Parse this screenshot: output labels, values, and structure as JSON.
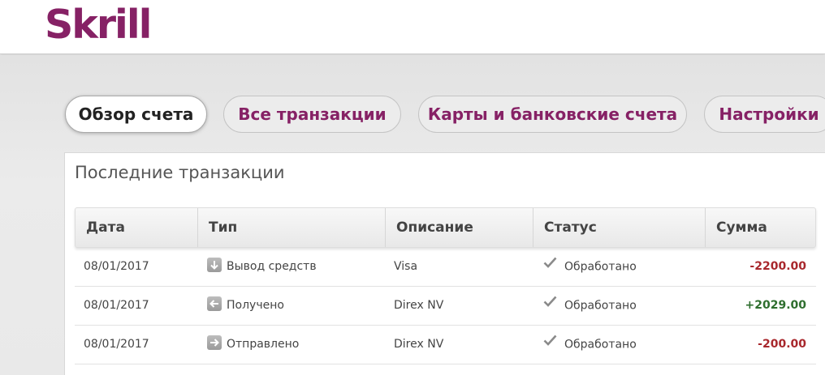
{
  "header": {
    "logo_text": "Skrill"
  },
  "tabs": [
    {
      "label": "Обзор счета",
      "active": true
    },
    {
      "label": "Все транзакции",
      "active": false
    },
    {
      "label": "Карты и банковские счета",
      "active": false
    },
    {
      "label": "Настройки",
      "active": false
    }
  ],
  "panel": {
    "title": "Последние транзакции",
    "columns": [
      "Дата",
      "Тип",
      "Описание",
      "Статус",
      "Сумма"
    ],
    "rows": [
      {
        "date": "08/01/2017",
        "type": "Вывод средств",
        "type_icon": "arrow-down-icon",
        "description": "Visa",
        "status": "Обработано",
        "amount": "-2200.00"
      },
      {
        "date": "08/01/2017",
        "type": "Получено",
        "type_icon": "arrow-left-icon",
        "description": "Direx NV",
        "status": "Обработано",
        "amount": "+2029.00"
      },
      {
        "date": "08/01/2017",
        "type": "Отправлено",
        "type_icon": "arrow-right-icon",
        "description": "Direx NV",
        "status": "Обработано",
        "amount": "-200.00"
      }
    ]
  },
  "colors": {
    "brand": "#862165",
    "negative": "#a8272c",
    "positive": "#2e6e2e",
    "check": "#8a8a8a"
  }
}
